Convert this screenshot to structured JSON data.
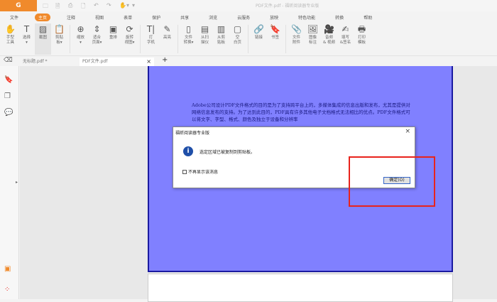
{
  "app": {
    "logo": "G",
    "title": "PDF文件.pdf - 福昕阅读器专业版"
  },
  "quick_access": [
    "🗀",
    "🗎",
    "⎙",
    "🗋",
    "↶",
    "↷",
    "✋▾",
    "▾"
  ],
  "menu": [
    "文件",
    "主页",
    "注释",
    "视图",
    "表单",
    "保护",
    "共享",
    "浏览",
    "云服务",
    "放映",
    "特色功能",
    "转换",
    "帮助"
  ],
  "active_menu": 1,
  "toolbar": [
    {
      "icon": "✋",
      "label": "手型\n工具",
      "group": 0
    },
    {
      "icon": "T",
      "label": "选择\n▾",
      "group": 0
    },
    {
      "icon": "▨",
      "label": "截图",
      "group": 0,
      "selected": true
    },
    {
      "icon": "📋",
      "label": "剪贴\n板▾",
      "group": 0
    },
    {
      "icon": "⊕",
      "label": "缩放\n▾",
      "group": 1
    },
    {
      "icon": "⇕",
      "label": "适合\n页面▾",
      "group": 1
    },
    {
      "icon": "▣",
      "label": "重排",
      "group": 1
    },
    {
      "icon": "⟳",
      "label": "旋转\n视图▾",
      "group": 1
    },
    {
      "icon": "T|",
      "label": "打\n字机",
      "group": 2
    },
    {
      "icon": "✎",
      "label": "高亮",
      "group": 2
    },
    {
      "icon": "▯",
      "label": "文件\n转换▾",
      "group": 3
    },
    {
      "icon": "▤",
      "label": "从扫\n描仪",
      "group": 3
    },
    {
      "icon": "▥",
      "label": "从剪\n贴板",
      "group": 3
    },
    {
      "icon": "▢",
      "label": "空\n白页",
      "group": 3
    },
    {
      "icon": "🔗",
      "label": "链接",
      "group": 4
    },
    {
      "icon": "🔖",
      "label": "书签",
      "group": 4
    },
    {
      "icon": "📎",
      "label": "文件\n附件",
      "group": 5
    },
    {
      "icon": "🖼",
      "label": "图像\n标注",
      "group": 5
    },
    {
      "icon": "🎥",
      "label": "音频\n& 视频",
      "group": 5
    },
    {
      "icon": "✍",
      "label": "填写\n&签名",
      "group": 5
    },
    {
      "icon": "🖶",
      "label": "打印\n模板",
      "group": 5
    }
  ],
  "tabs": [
    {
      "label": "无标题.pdf *"
    },
    {
      "label": "PDF文件.pdf",
      "close": "×"
    }
  ],
  "new_tab": "+",
  "document_text": "Adobe公司设计PDF文件格式的目的是为了支持跨平台上的，多媒体集成的信息出版和发布，尤其是提供对网络信息发布的支持。为了达到此目的，PDF具有许多其他电子文档格式无法相比的优点。PDF文件格式可以将文字、字型、格式、颜色及独立于设备和分辨率",
  "dialog": {
    "title": "福昕阅读器专业版",
    "close": "×",
    "message": "选定区域已被复制到剪贴板。",
    "checkbox_label": "不再显示该消息",
    "ok_button": "确定(O)"
  },
  "colors": {
    "accent": "#f08a2c",
    "page": "#8080ff",
    "highlight": "#e8231c"
  }
}
